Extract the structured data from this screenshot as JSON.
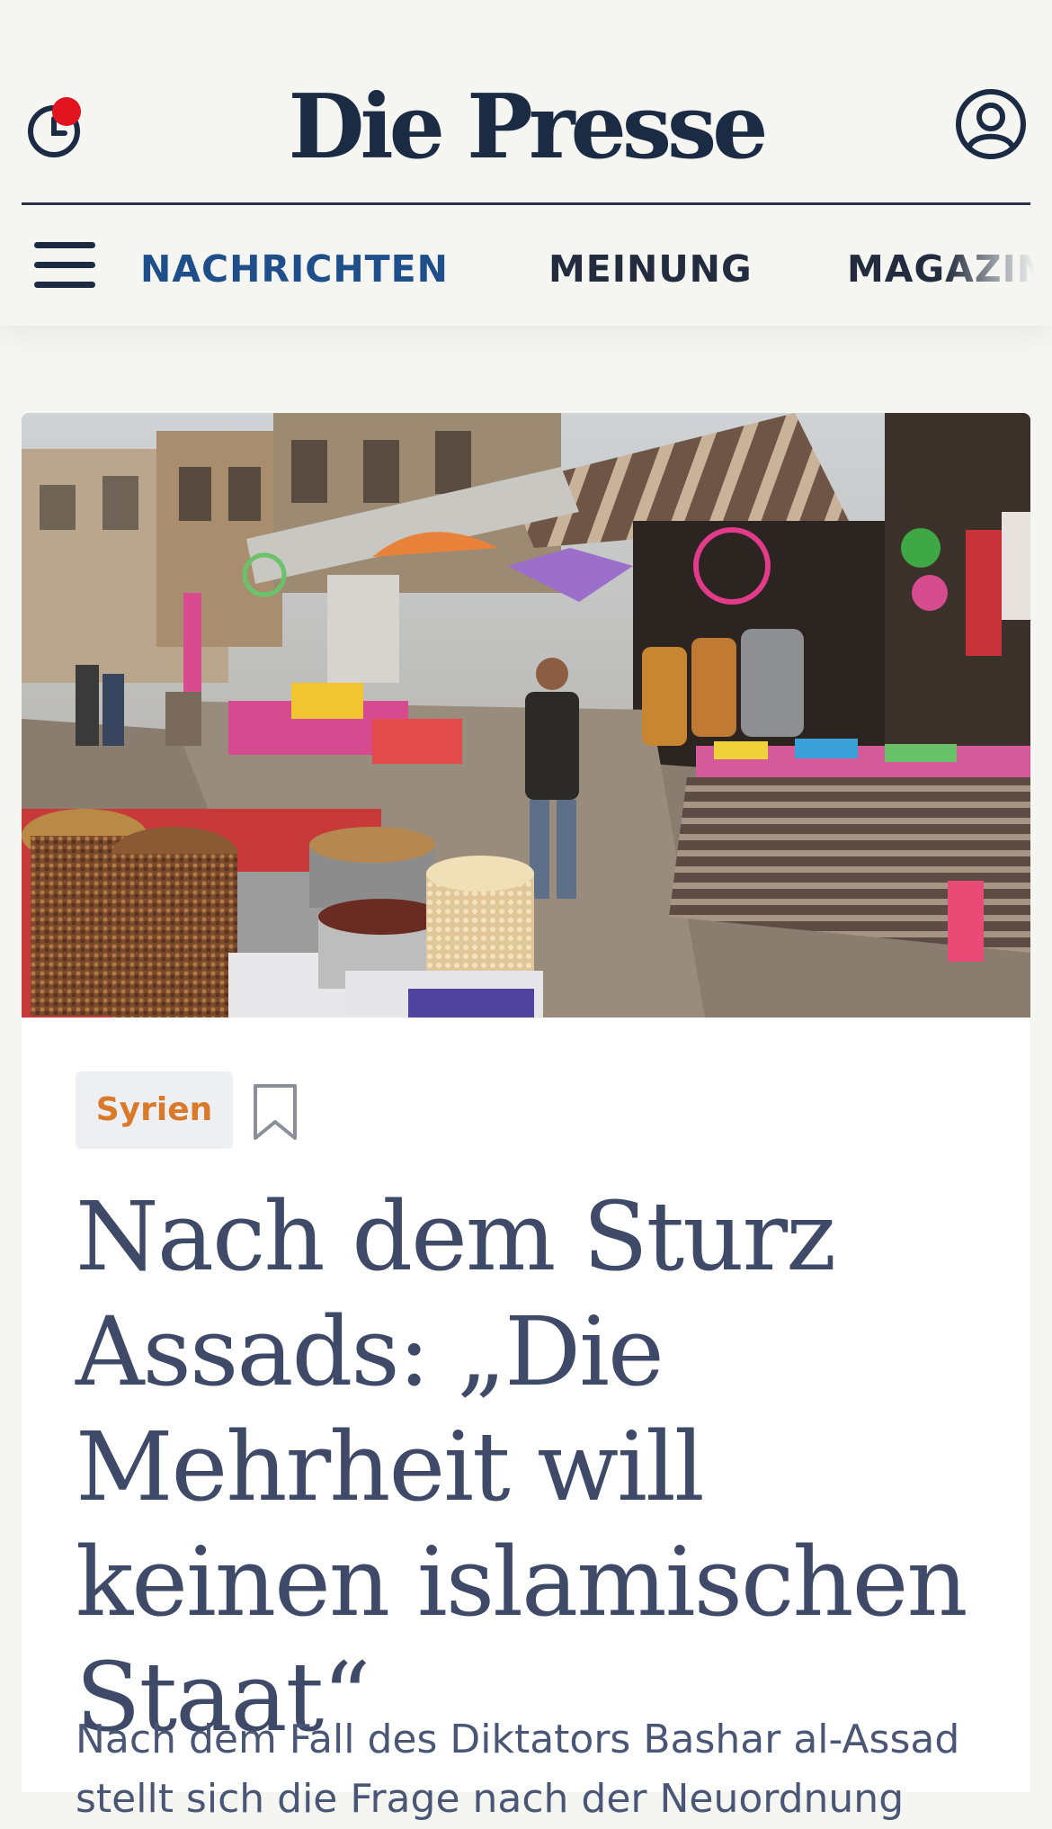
{
  "header": {
    "logo": "Die Presse",
    "nav": [
      {
        "label": "NACHRICHTEN",
        "active": true
      },
      {
        "label": "MEINUNG",
        "active": false
      },
      {
        "label": "MAGAZIN",
        "active": false
      }
    ]
  },
  "article": {
    "tag": "Syrien",
    "headline": "Nach dem Sturz Assads: „Die Mehrheit will keinen islamischen Staat“",
    "lead": "Nach dem Fall des Diktators Bashar al-Assad stellt sich die Frage nach der Neuordnung"
  },
  "colors": {
    "accent_nav": "#1e4f8a",
    "tag_text": "#d97a2b",
    "notification": "#e2141f",
    "headline": "#3e4a68"
  },
  "icons": [
    "clock-icon",
    "user-icon",
    "menu-icon",
    "bookmark-icon"
  ]
}
